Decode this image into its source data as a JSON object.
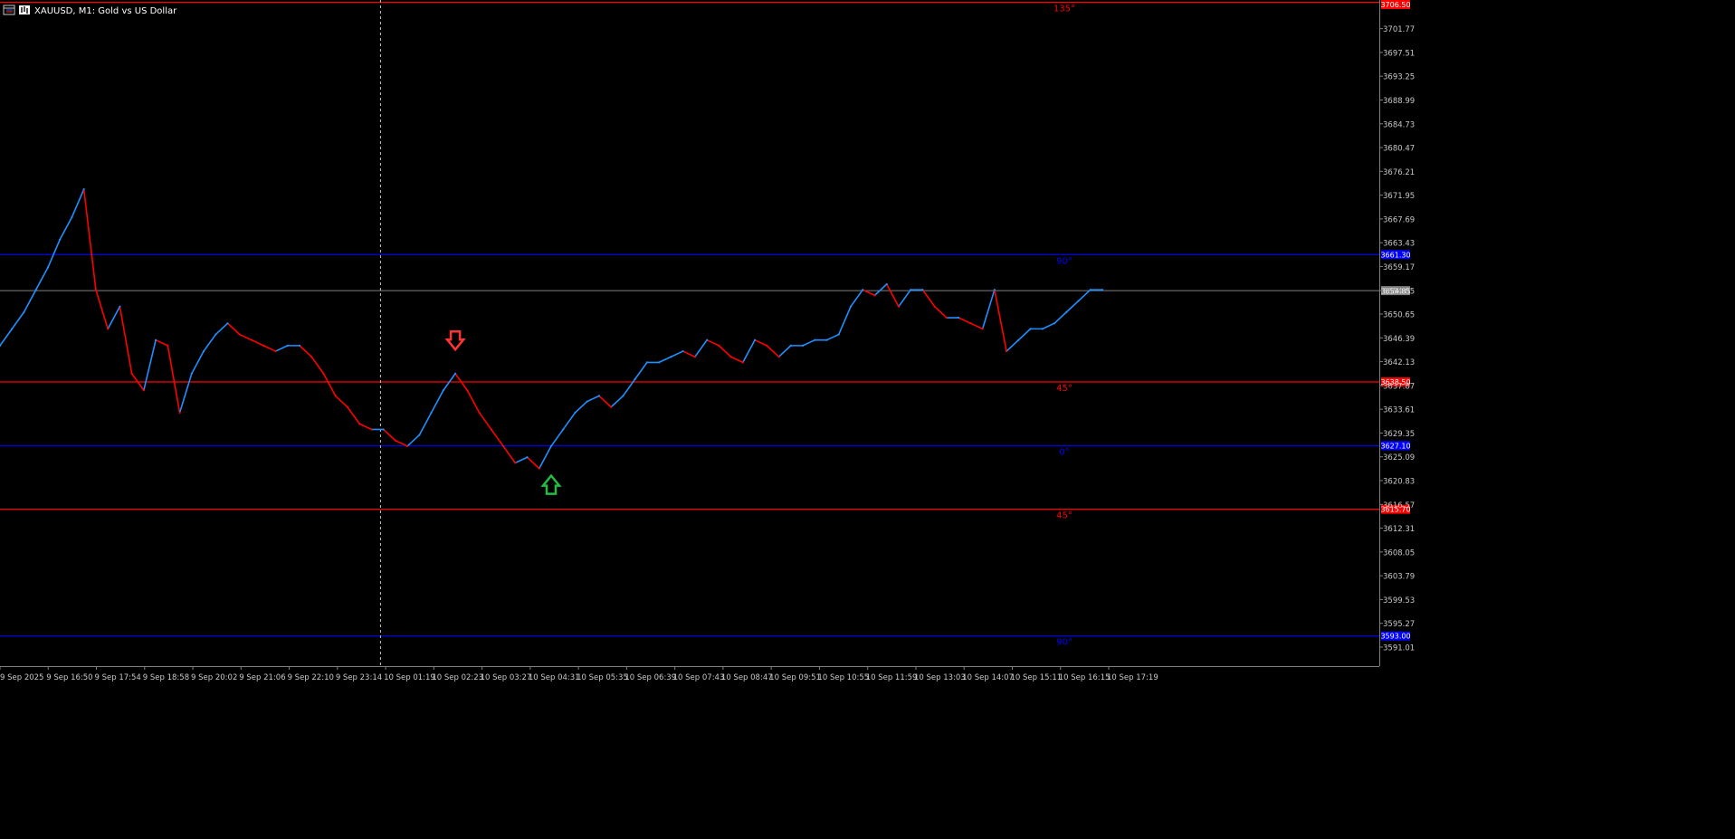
{
  "window": {
    "title": "XAUUSD, M1:  Gold vs US Dollar",
    "icon": "chart-window-icon",
    "bars_icon": "bars-icon"
  },
  "colors": {
    "background": "#000000",
    "up_line": "#1e90ff",
    "down_line": "#ff0000",
    "axis_text": "#c8c8c8",
    "axis_border": "#808080",
    "grid_blue": "#0000ff",
    "grid_red": "#ff0000",
    "current_price_line": "#808080",
    "crosshair": "#c8c8c8",
    "sell_arrow": "#ff3333",
    "buy_arrow": "#22bb44"
  },
  "chart_data": {
    "type": "line",
    "symbol": "XAUUSD",
    "timeframe": "M1",
    "title": "XAUUSD, M1:  Gold vs US Dollar",
    "xlabel": "",
    "ylabel": "",
    "ylim": [
      3587.6,
      3706.9
    ],
    "grid": false,
    "y_ticks": [
      "3701.77",
      "3697.51",
      "3693.25",
      "3688.99",
      "3684.73",
      "3680.47",
      "3676.21",
      "3671.95",
      "3667.69",
      "3663.43",
      "3659.17",
      "3654.85",
      "3650.65",
      "3646.39",
      "3642.13",
      "3637.87",
      "3633.61",
      "3629.35",
      "3625.09",
      "3620.83",
      "3616.57",
      "3612.31",
      "3608.05",
      "3603.79",
      "3599.53",
      "3595.27",
      "3591.01"
    ],
    "x_ticks": [
      "9 Sep 2025",
      "9 Sep 16:50",
      "9 Sep 17:54",
      "9 Sep 18:58",
      "9 Sep 20:02",
      "9 Sep 21:06",
      "9 Sep 22:10",
      "9 Sep 23:14",
      "10 Sep 01:19",
      "10 Sep 02:23",
      "10 Sep 03:27",
      "10 Sep 04:31",
      "10 Sep 05:35",
      "10 Sep 06:39",
      "10 Sep 07:43",
      "10 Sep 08:47",
      "10 Sep 09:51",
      "10 Sep 10:55",
      "10 Sep 11:59",
      "10 Sep 13:03",
      "10 Sep 14:07",
      "10 Sep 15:11",
      "10 Sep 16:15",
      "10 Sep 17:19"
    ],
    "current_price": 3654.85,
    "current_price_label": "3654.85",
    "series": [
      {
        "values": [
          3645,
          3648,
          3651,
          3655,
          3659,
          3664,
          3668,
          3673,
          3655,
          3648,
          3652,
          3640,
          3637,
          3646,
          3645,
          3633,
          3640,
          3644,
          3647,
          3649,
          3647,
          3646,
          3645,
          3644,
          3645,
          3645,
          3643,
          3640,
          3636,
          3634,
          3631,
          3630,
          3630,
          3628,
          3627,
          3629,
          3633,
          3637,
          3640,
          3637,
          3633,
          3630,
          3627,
          3624,
          3625,
          3623,
          3627,
          3630,
          3633,
          3635,
          3636,
          3634,
          3636,
          3639,
          3642,
          3642,
          3643,
          3644,
          3643,
          3646,
          3645,
          3643,
          3642,
          3646,
          3645,
          3643,
          3645,
          3645,
          3646,
          3646,
          3647,
          3652,
          3655,
          3654,
          3656,
          3652,
          3655,
          3655,
          3652,
          3650,
          3650,
          3649,
          3648,
          3655,
          3644,
          3646,
          3648,
          3648,
          3649,
          3651,
          3653,
          3655,
          3655
        ]
      }
    ],
    "levels": [
      {
        "price": 3661.3,
        "color": "#0000ff",
        "angle_label": "90°",
        "axis_label": "3661.30"
      },
      {
        "price": 3638.5,
        "color": "#ff0000",
        "angle_label": "45°",
        "axis_label": "3638.50"
      },
      {
        "price": 3627.1,
        "color": "#0000ff",
        "angle_label": "0°",
        "axis_label": "3627.10"
      },
      {
        "price": 3615.7,
        "color": "#ff0000",
        "angle_label": "45°",
        "axis_label": "3615.70"
      },
      {
        "price": 3593.0,
        "color": "#0000ff",
        "angle_label": "90°",
        "axis_label": "3593.00"
      },
      {
        "price": 3706.5,
        "color": "#ff0000",
        "angle_label": "135°",
        "axis_label": "3706.50"
      }
    ],
    "markers": [
      {
        "type": "sell-arrow",
        "index": 38,
        "price": 3643
      },
      {
        "type": "buy-arrow",
        "index": 46,
        "price": 3623
      }
    ],
    "crosshair_index": 31
  }
}
